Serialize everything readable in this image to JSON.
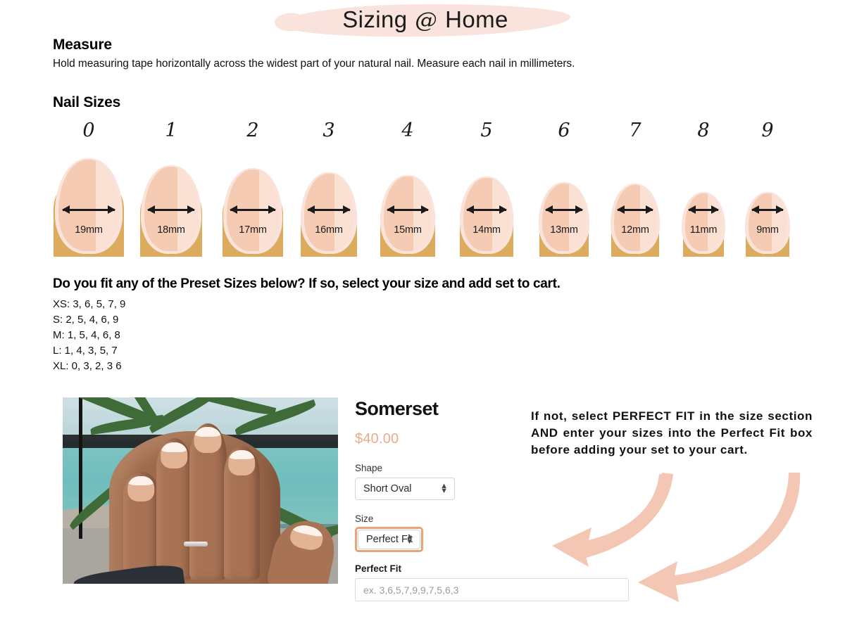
{
  "title": {
    "text_before": "Sizing ",
    "at_symbol": "@",
    "text_after": " Home"
  },
  "measure": {
    "heading": "Measure",
    "body": "Hold measuring tape horizontally across the widest part of your natural nail. Measure each nail in millimeters."
  },
  "nail_sizes": {
    "heading": "Nail Sizes",
    "items": [
      {
        "number": "0",
        "mm": "19mm"
      },
      {
        "number": "1",
        "mm": "18mm"
      },
      {
        "number": "2",
        "mm": "17mm"
      },
      {
        "number": "3",
        "mm": "16mm"
      },
      {
        "number": "4",
        "mm": "15mm"
      },
      {
        "number": "5",
        "mm": "14mm"
      },
      {
        "number": "6",
        "mm": "13mm"
      },
      {
        "number": "7",
        "mm": "12mm"
      },
      {
        "number": "8",
        "mm": "11mm"
      },
      {
        "number": "9",
        "mm": "9mm"
      }
    ]
  },
  "presets": {
    "heading": "Do you fit any of the Preset Sizes below? If so, select your size and add set to cart.",
    "rows": [
      "XS: 3, 6, 5, 7, 9",
      "S: 2, 5, 4, 6, 9",
      "M: 1, 5, 4, 6, 8",
      "L: 1, 4, 3, 5, 7",
      "XL: 0, 3, 2, 3 6"
    ]
  },
  "product": {
    "name": "Somerset",
    "price": "$40.00",
    "shape": {
      "label": "Shape",
      "value": "Short Oval"
    },
    "size": {
      "label": "Size",
      "value": "Perfect Fit"
    },
    "perfect_fit": {
      "label": "Perfect Fit",
      "placeholder": "ex. 3,6,5,7,9,9,7,5,6,3",
      "value": ""
    }
  },
  "note": "If not, select PERFECT FIT in the size section AND enter your sizes into the Perfect Fit  box before adding your set to your cart.",
  "colors": {
    "brush_pink": "#f9e3dc",
    "arrow_pink": "#f3c7b4",
    "price_salmon": "#ecab8d",
    "focus_orange": "#e9a475",
    "finger_gold": "#dcab5e",
    "nail_plate": "#f6cbb4",
    "nail_outline": "#fae3db"
  }
}
